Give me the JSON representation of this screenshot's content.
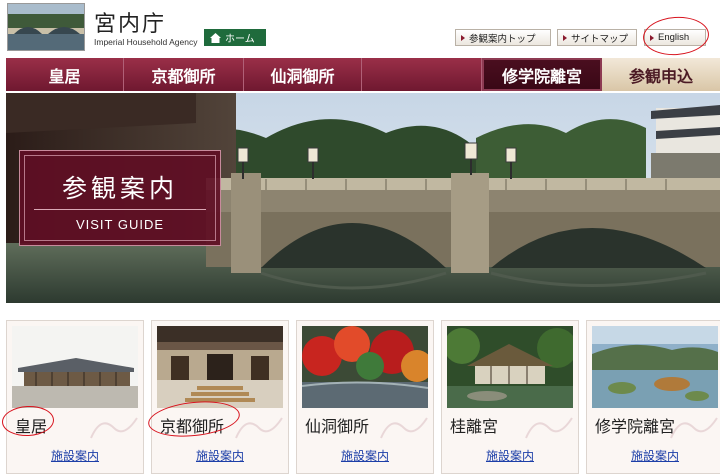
{
  "header": {
    "logo_ja": "宮内庁",
    "logo_en": "Imperial Household Agency",
    "home_label": "ホーム",
    "buttons": [
      {
        "label": "参観案内トップ"
      },
      {
        "label": "サイトマップ"
      },
      {
        "label": "English"
      }
    ]
  },
  "nav": {
    "items": [
      {
        "label": "皇居"
      },
      {
        "label": "京都御所"
      },
      {
        "label": "仙洞御所"
      },
      {
        "label": ""
      },
      {
        "label": "修学院離宮"
      },
      {
        "label": "参観申込"
      }
    ]
  },
  "hero": {
    "title": "参観案内",
    "subtitle": "VISIT GUIDE"
  },
  "cards": [
    {
      "name": "皇居",
      "link": "施設案内"
    },
    {
      "name": "京都御所",
      "link": "施設案内"
    },
    {
      "name": "仙洞御所",
      "link": "施設案内"
    },
    {
      "name": "桂離宮",
      "link": "施設案内"
    },
    {
      "name": "修学院離宮",
      "link": "施設案内"
    }
  ],
  "colors": {
    "nav_bg": "#7e2039",
    "hero_panel": "#5f0e24",
    "home_green": "#1f6b3c",
    "annotation_red": "#d8141e",
    "link_blue": "#1d3fa8"
  }
}
